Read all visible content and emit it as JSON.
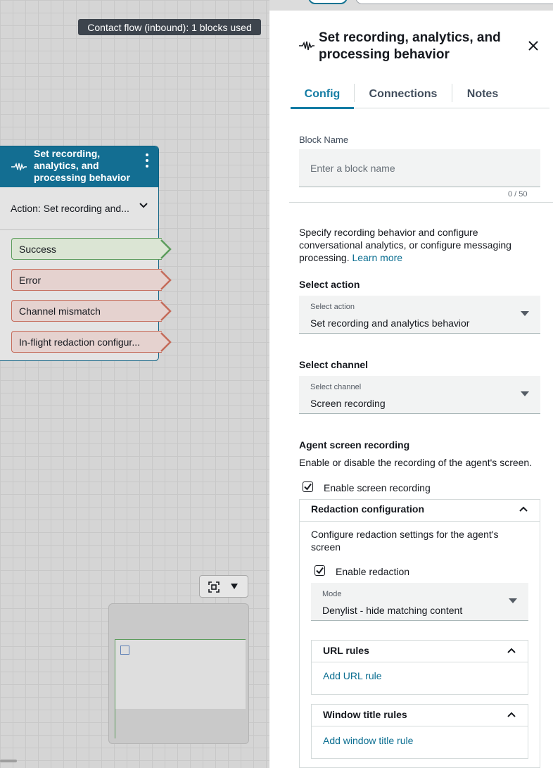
{
  "canvas": {
    "flow_badge": "Contact flow (inbound): 1 blocks used",
    "block": {
      "title": "Set recording, analytics, and processing behavior",
      "action": "Action: Set recording and...",
      "branches": [
        {
          "label": "Success",
          "status": "ok"
        },
        {
          "label": "Error",
          "status": "bad"
        },
        {
          "label": "Channel mismatch",
          "status": "bad"
        },
        {
          "label": "In-flight redaction configur...",
          "status": "bad"
        }
      ]
    }
  },
  "panel": {
    "title": "Set recording, analytics, and processing behavior",
    "tabs": [
      {
        "label": "Config",
        "active": true
      },
      {
        "label": "Connections",
        "active": false
      },
      {
        "label": "Notes",
        "active": false
      }
    ],
    "block_name": {
      "label": "Block Name",
      "placeholder": "Enter a block name",
      "counter": "0 / 50"
    },
    "description": "Specify recording behavior and configure conversational analytics, or configure messaging processing.",
    "learn_more": "Learn more",
    "select_action": {
      "heading": "Select action",
      "label": "Select action",
      "value": "Set recording and analytics behavior"
    },
    "select_channel": {
      "heading": "Select channel",
      "label": "Select channel",
      "value": "Screen recording"
    },
    "agent_screen": {
      "heading": "Agent screen recording",
      "description": "Enable or disable the recording of the agent's screen.",
      "enable_label": "Enable screen recording",
      "enable_checked": true
    },
    "redaction": {
      "heading": "Redaction configuration",
      "description": "Configure redaction settings for the agent's screen",
      "enable_label": "Enable redaction",
      "enable_checked": true,
      "mode": {
        "label": "Mode",
        "value": "Denylist - hide matching content"
      },
      "url_rules": {
        "heading": "URL rules",
        "link": "Add URL rule"
      },
      "window_rules": {
        "heading": "Window title rules",
        "link": "Add window title rule"
      }
    }
  },
  "colors": {
    "accent": "#137ca4",
    "block_header": "#136e92",
    "success": "#5c9c5c",
    "error": "#c56b5a"
  }
}
